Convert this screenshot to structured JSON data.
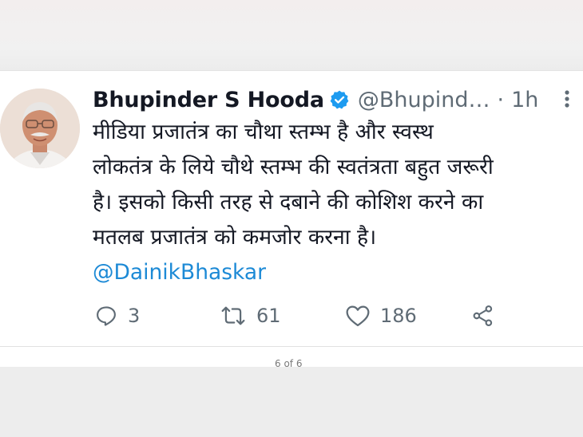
{
  "tweet": {
    "author_name": "Bhupinder S Hooda",
    "handle": "@Bhupind…",
    "separator": "·",
    "time": "1h",
    "lines": [
      "मीडिया प्रजातंत्र का चौथा स्तम्भ है और स्वस्थ",
      "लोकतंत्र के लिये चौथे स्तम्भ की स्वतंत्रता बहुत जरूरी",
      "है। इसको किसी तरह से दबाने की कोशिश करने का",
      "मतलब प्रजातंत्र को कमजोर करना है।"
    ],
    "mention": "@DainikBhaskar"
  },
  "actions": {
    "reply_count": "3",
    "retweet_count": "61",
    "like_count": "186"
  },
  "footer": {
    "page_indicator": "6 of 6"
  },
  "colors": {
    "verified": "#1d9bf0",
    "mention": "#1d8ad6",
    "muted": "#5f6b75"
  },
  "icons": [
    "verified-badge-icon",
    "more-options-icon",
    "reply-icon",
    "retweet-icon",
    "like-icon",
    "share-icon"
  ]
}
